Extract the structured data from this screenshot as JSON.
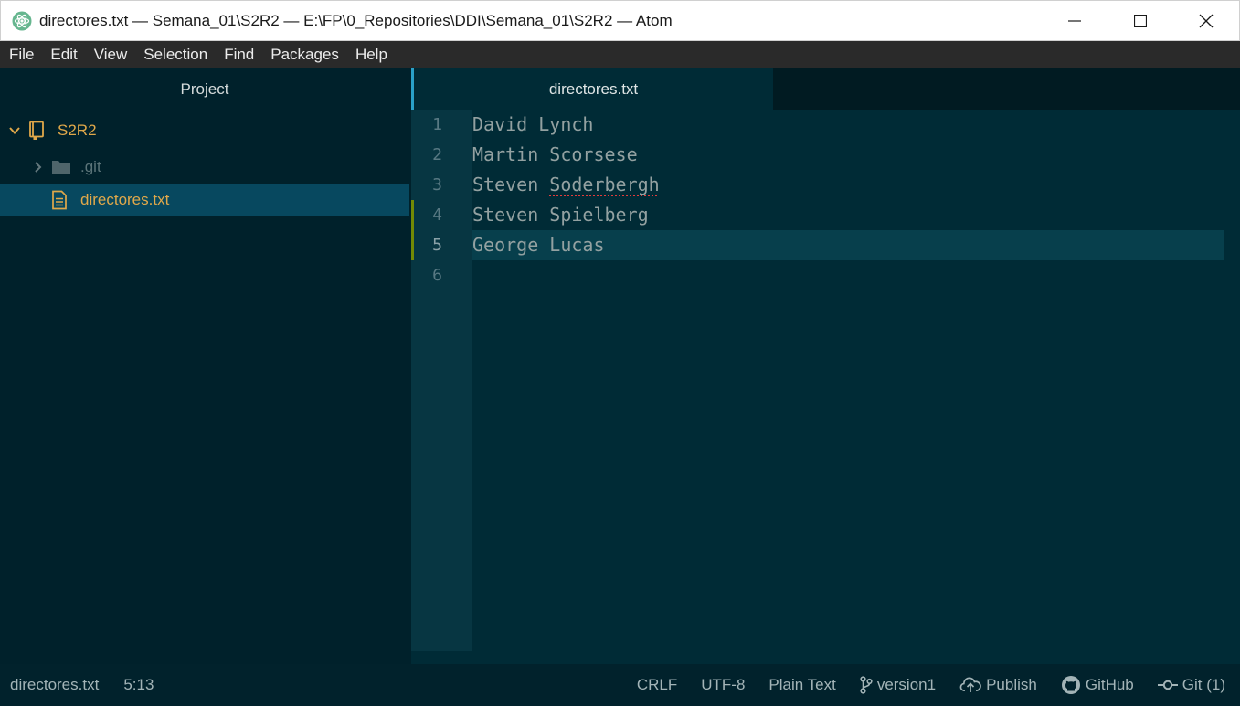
{
  "window": {
    "title": "directores.txt — Semana_01\\S2R2 — E:\\FP\\0_Repositories\\DDI\\Semana_01\\S2R2 — Atom"
  },
  "menu": [
    "File",
    "Edit",
    "View",
    "Selection",
    "Find",
    "Packages",
    "Help"
  ],
  "sidebar": {
    "header": "Project",
    "root": "S2R2",
    "items": [
      {
        "label": ".git",
        "type": "folder"
      },
      {
        "label": "directores.txt",
        "type": "file",
        "selected": true
      }
    ]
  },
  "editor": {
    "tab_title": "directores.txt",
    "line_numbers": [
      "1",
      "2",
      "3",
      "4",
      "5",
      "6"
    ],
    "lines": {
      "l1": "David Lynch",
      "l2": "Martin Scorsese",
      "l3a": "Steven ",
      "l3b": "Soderbergh",
      "l4": "Steven Spielberg",
      "l5": "George Lucas",
      "l6": ""
    }
  },
  "status": {
    "file": "directores.txt",
    "cursor": "5:13",
    "line_ending": "CRLF",
    "encoding": "UTF-8",
    "grammar": "Plain Text",
    "branch": "version1",
    "publish": "Publish",
    "github": "GitHub",
    "git": "Git (1)"
  },
  "colors": {
    "background": "#002b36",
    "sidebar_selected": "#07485f",
    "accent": "#2aa1c9",
    "git_modified": "#738a05"
  }
}
